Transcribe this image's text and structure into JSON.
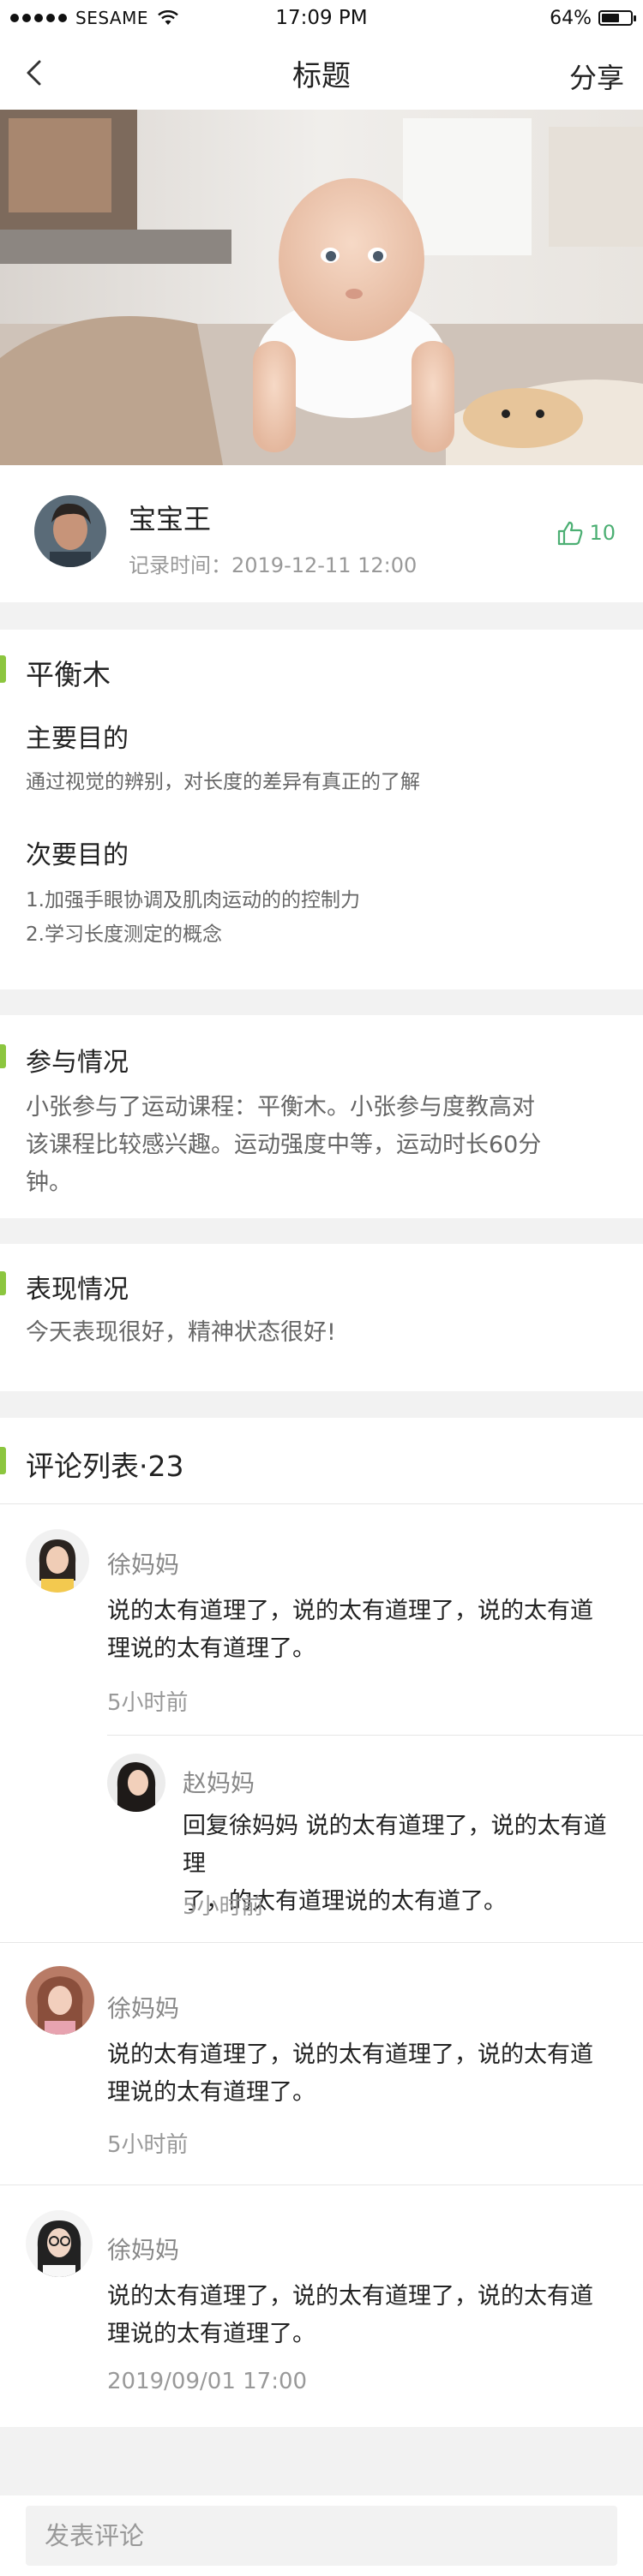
{
  "status_bar": {
    "carrier": "SESAME",
    "time": "17:09 PM",
    "battery": "64%",
    "battery_level": 0.64
  },
  "nav": {
    "title": "标题",
    "share_label": "分享"
  },
  "author": {
    "name": "宝宝王",
    "record_time": "记录时间：2019-12-11 12:00",
    "likes": "10"
  },
  "activity": {
    "title": "平衡木",
    "primary_goal_label": "主要目的",
    "primary_goal_text": "通过视觉的辨别，对长度的差异有真正的了解",
    "secondary_goal_label": "次要目的",
    "secondary_goal_items": [
      "1.加强手眼协调及肌肉运动的的控制力",
      "2.学习长度测定的概念"
    ]
  },
  "participation": {
    "title": "参与情况",
    "lines": [
      "小张参与了运动课程：平衡木。小张参与度教高对",
      "该课程比较感兴趣。运动强度中等，运动时长60分",
      "钟。"
    ]
  },
  "performance": {
    "title": "表现情况",
    "text": "今天表现很好，精神状态很好!"
  },
  "comments": {
    "title": "评论列表·23",
    "items": [
      {
        "name": "徐妈妈",
        "lines": [
          "说的太有道理了，说的太有道理了，说的太有道",
          "理说的太有道理了。"
        ],
        "time": "5小时前",
        "reply": {
          "name": "赵妈妈",
          "lines": [
            "回复徐妈妈 说的太有道理了，说的太有道理",
            "了，的太有道理说的太有道了。"
          ],
          "time": "5小时前"
        }
      },
      {
        "name": "徐妈妈",
        "lines": [
          "说的太有道理了，说的太有道理了，说的太有道",
          "理说的太有道理了。"
        ],
        "time": "5小时前"
      },
      {
        "name": "徐妈妈",
        "lines": [
          "说的太有道理了，说的太有道理了，说的太有道",
          "理说的太有道理了。"
        ],
        "time": "2019/09/01 17:00"
      }
    ]
  },
  "bottom": {
    "comment_placeholder": "发表评论"
  },
  "colors": {
    "accent_green": "#8cc63f",
    "like_green": "#4caf73",
    "background": "#f2f2f2"
  }
}
